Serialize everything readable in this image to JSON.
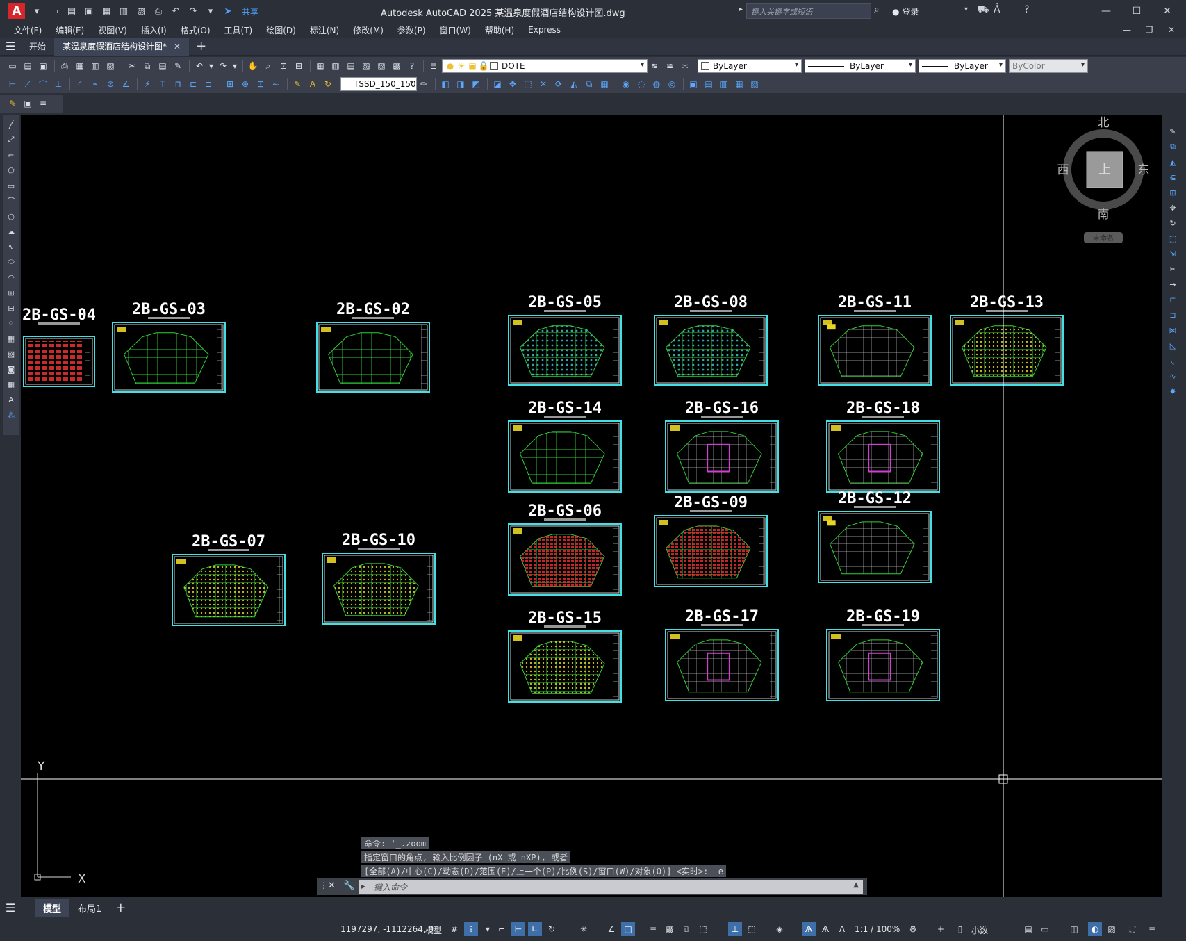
{
  "app": {
    "title": "Autodesk AutoCAD 2025    某温泉度假酒店结构设计图.dwg",
    "logo_letter": "A",
    "share_label": "共享",
    "search_placeholder": "键入关键字或短语",
    "login_label": "登录",
    "accent_color": "#d6262b"
  },
  "menu": [
    "文件(F)",
    "编辑(E)",
    "视图(V)",
    "插入(I)",
    "格式(O)",
    "工具(T)",
    "绘图(D)",
    "标注(N)",
    "修改(M)",
    "参数(P)",
    "窗口(W)",
    "帮助(H)",
    "Express"
  ],
  "tabs": {
    "start_label": "开始",
    "document_label": "某温泉度假酒店结构设计图*"
  },
  "toolbar": {
    "layer_name": "DOTE",
    "color_value": "ByLayer",
    "linetype_value": "ByLayer",
    "lineweight_value": "ByLayer",
    "plotstyle_value": "ByColor",
    "dimstyle_value": "TSSD_150_150"
  },
  "viewcube": {
    "north": "北",
    "south": "南",
    "east": "东",
    "west": "西",
    "face": "上",
    "wcs_label": "未命名"
  },
  "ucs": {
    "x_label": "X",
    "y_label": "Y"
  },
  "sheets": [
    {
      "label": "2B-GS-04"
    },
    {
      "label": "2B-GS-03"
    },
    {
      "label": "2B-GS-02"
    },
    {
      "label": "2B-GS-05"
    },
    {
      "label": "2B-GS-08"
    },
    {
      "label": "2B-GS-11"
    },
    {
      "label": "2B-GS-13"
    },
    {
      "label": "2B-GS-14"
    },
    {
      "label": "2B-GS-16"
    },
    {
      "label": "2B-GS-18"
    },
    {
      "label": "2B-GS-06"
    },
    {
      "label": "2B-GS-09"
    },
    {
      "label": "2B-GS-12"
    },
    {
      "label": "2B-GS-07"
    },
    {
      "label": "2B-GS-10"
    },
    {
      "label": "2B-GS-15"
    },
    {
      "label": "2B-GS-17"
    },
    {
      "label": "2B-GS-19"
    }
  ],
  "command": {
    "history_1": "命令: '_.zoom",
    "history_2": "指定窗口的角点, 输入比例因子 (nX 或 nXP), 或者",
    "history_3": "[全部(A)/中心(C)/动态(D)/范围(E)/上一个(P)/比例(S)/窗口(W)/对象(O)] <实时>: _e",
    "input_placeholder": "键入命令"
  },
  "layout_tabs": {
    "model": "模型",
    "layout1": "布局1"
  },
  "status": {
    "coordinates": "1197297, -1112264, 0",
    "model_label": "模型",
    "scale": "1:1 / 100%",
    "units": "小数"
  }
}
